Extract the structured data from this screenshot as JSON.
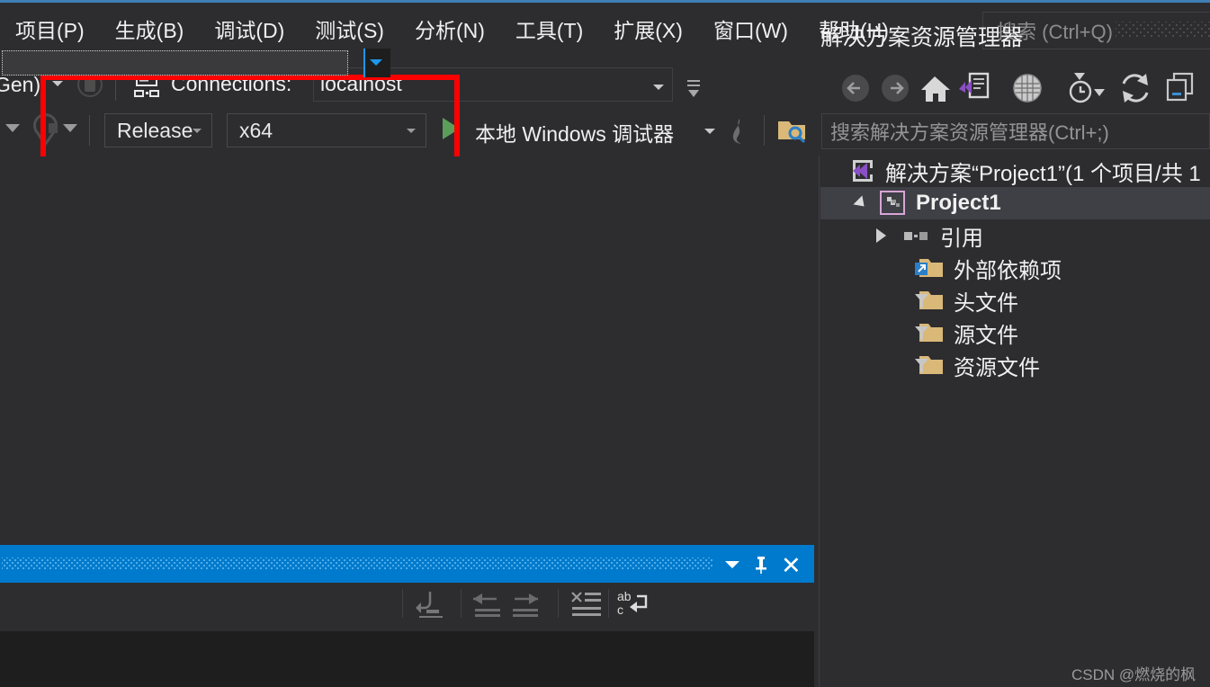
{
  "window": {
    "theme_bg": "#2d2d30",
    "accent": "#007acc",
    "annotation_color": "#fe0000"
  },
  "menubar": {
    "items": [
      {
        "label": "项目(P)",
        "name": "menu-project"
      },
      {
        "label": "生成(B)",
        "name": "menu-build"
      },
      {
        "label": "调试(D)",
        "name": "menu-debug"
      },
      {
        "label": "测试(S)",
        "name": "menu-test"
      },
      {
        "label": "分析(N)",
        "name": "menu-analyze"
      },
      {
        "label": "工具(T)",
        "name": "menu-tools"
      },
      {
        "label": "扩展(X)",
        "name": "menu-extensions"
      },
      {
        "label": "窗口(W)",
        "name": "menu-window"
      },
      {
        "label": "帮助(H)",
        "name": "menu-help"
      }
    ],
    "search_placeholder": "搜索 (Ctrl+Q)"
  },
  "toolbar_connections": {
    "partial_left_label": "Gen)",
    "connections_label": "Connections:",
    "connection_value": "localhost"
  },
  "toolbar_build": {
    "configuration": "Release",
    "platform": "x64",
    "debug_target": "本地 Windows 调试器",
    "icons": [
      "home-icon",
      "cube-run-icon",
      "cube-next-icon",
      "cube-search-icon",
      "cube-stepinto-icon",
      "cube-stepover-icon",
      "cube-circle-icon"
    ],
    "coordinates_text": "(?, ?,"
  },
  "solution_explorer": {
    "title": "解决方案资源管理器",
    "search_placeholder": "搜索解决方案资源管理器(Ctrl+;)",
    "toolbar_icons": [
      "back-arrow-icon",
      "forward-arrow-icon",
      "home-icon",
      "code-view-icon",
      "globe-icon",
      "pending-changes-icon",
      "refresh-icon",
      "collapse-all-icon"
    ],
    "tree": [
      {
        "label": "解决方案“Project1”(1 个项目/共 1",
        "icon": "solution-icon",
        "indent": 0,
        "selected": false,
        "expander": "none"
      },
      {
        "label": "Project1",
        "icon": "project-icon",
        "indent": 1,
        "selected": true,
        "expander": "open"
      },
      {
        "label": "引用",
        "icon": "references-icon",
        "indent": 2,
        "selected": false,
        "expander": "closed"
      },
      {
        "label": "外部依赖项",
        "icon": "external-deps-folder-icon",
        "indent": 3,
        "selected": false,
        "expander": "none"
      },
      {
        "label": "头文件",
        "icon": "filter-folder-icon",
        "indent": 3,
        "selected": false,
        "expander": "none"
      },
      {
        "label": "源文件",
        "icon": "filter-folder-icon",
        "indent": 3,
        "selected": false,
        "expander": "none"
      },
      {
        "label": "资源文件",
        "icon": "filter-folder-icon",
        "indent": 3,
        "selected": false,
        "expander": "none"
      }
    ]
  },
  "output_panel": {
    "title": "",
    "combo_value": "",
    "toolbar_icons": [
      "jump-to-source-icon",
      "previous-message-icon",
      "next-message-icon",
      "clear-all-icon",
      "toggle-word-wrap-icon"
    ]
  },
  "watermark": "CSDN @燃烧的枫"
}
